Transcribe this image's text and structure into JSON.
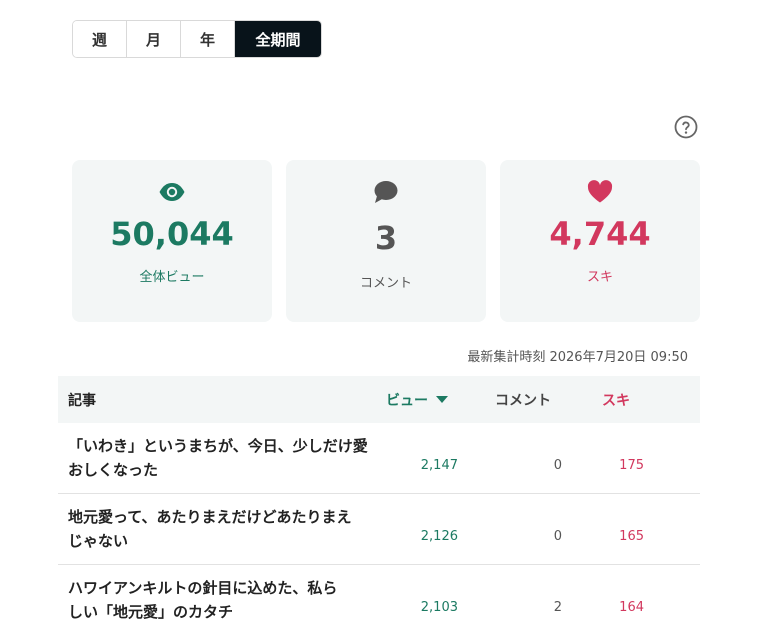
{
  "period_tabs": [
    {
      "label": "週",
      "active": false
    },
    {
      "label": "月",
      "active": false
    },
    {
      "label": "年",
      "active": false
    },
    {
      "label": "全期間",
      "active": true
    }
  ],
  "help_icon": "question-circle-icon",
  "stats": {
    "views": {
      "icon": "eye-icon",
      "value": "50,044",
      "label": "全体ビュー",
      "color": "#1c7a62"
    },
    "comments": {
      "icon": "speech-bubble-icon",
      "value": "3",
      "label": "コメント",
      "color": "#555555"
    },
    "likes": {
      "icon": "heart-icon",
      "value": "4,744",
      "label": "スキ",
      "color": "#d2385e"
    }
  },
  "updated_at": "最新集計時刻 2026年7月20日 09:50",
  "table": {
    "headers": {
      "article": "記事",
      "views": "ビュー",
      "comments": "コメント",
      "likes": "スキ"
    },
    "sort_indicator": "sort-desc-icon",
    "rows": [
      {
        "title_line1": "「いわき」というまちが、今日、少しだけ愛",
        "title_line2": "おしくなった",
        "views": "2,147",
        "comments": "0",
        "likes": "175"
      },
      {
        "title_line1": "地元愛って、あたりまえだけどあたりまえ",
        "title_line2": "じゃない",
        "views": "2,126",
        "comments": "0",
        "likes": "165"
      },
      {
        "title_line1": "ハワイアンキルトの針目に込めた、私ら",
        "title_line2": "しい「地元愛」のカタチ",
        "views": "2,103",
        "comments": "2",
        "likes": "164"
      }
    ]
  }
}
